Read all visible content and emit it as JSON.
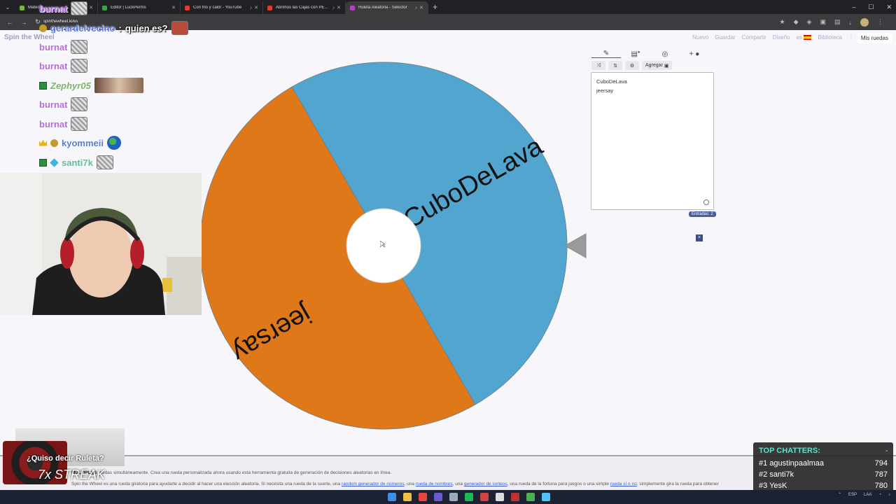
{
  "browser": {
    "tabs": [
      {
        "label": "Matecat...",
        "color": "#7cb342",
        "audio": false,
        "active": false
      },
      {
        "label": "Editor | LuckPerms",
        "color": "#43a047",
        "audio": false,
        "active": false
      },
      {
        "label": "Con frio y calor - YouTube",
        "color": "#e53935",
        "audio": true,
        "active": false
      },
      {
        "label": "Abrimos las Cajas con PEORES",
        "color": "#e53935",
        "audio": true,
        "active": false
      },
      {
        "label": "Ruleta Aleatoria - Selector",
        "color": "#ab47bc",
        "audio": true,
        "active": true
      }
    ],
    "new_tab": "+",
    "window_controls": [
      "–",
      "☐",
      "✕"
    ]
  },
  "site": {
    "logo": "Spin the Wheel",
    "nav": [
      "Nuevo",
      "Guardar",
      "Compartir",
      "Diseño",
      "es",
      "Biblioteca",
      "⋮"
    ],
    "my_wheels": "Mis ruedas"
  },
  "wheel": {
    "segments": [
      {
        "label": "CuboDeLava",
        "color": "#52a5cf"
      },
      {
        "label": "jeersay",
        "color": "#df7818"
      }
    ]
  },
  "editor": {
    "add_label": "Agregar",
    "entries": [
      "CuboDeLava",
      "jeersay"
    ],
    "entries_count": "Entradas: 2",
    "close": "×"
  },
  "chat": {
    "lines": [
      {
        "user": "burnat",
        "style": "purple"
      },
      {
        "user": "gerardelvecino",
        "style": "blue",
        "message": "quien es?"
      },
      {
        "user": "burnat",
        "style": "purple"
      },
      {
        "user": "burnat",
        "style": "purple"
      },
      {
        "user": "Zephyr05",
        "style": "rainbow"
      },
      {
        "user": "burnat",
        "style": "purple"
      },
      {
        "user": "burnat",
        "style": "purple"
      },
      {
        "user": "kyommeii",
        "style": "blue"
      },
      {
        "user": "santi7k",
        "style": "teal"
      }
    ],
    "small_tag": "spinthewheel.io/es"
  },
  "streak": {
    "question": "¿Quiso decir Ruleta?",
    "count": "7x STREAK"
  },
  "footer": {
    "line1_bold": "MÚLTIPLES",
    "line1": "ruedas simultáneamente. Crea una rueda personalizada ahora usando esta herramienta gratuita de generación de decisiones aleatorias en línea.",
    "line2_a": "Spin the Wheel es una rueda giratoria para ayudarte a decidir al hacer una elección aleatoria. Si necesita una rueda de la suerte, una",
    "link1": "random generador de números",
    "line2_b": ", una",
    "link2": "rueda de nombres",
    "line2_c": ", una",
    "link3": "generador de sorteos",
    "line2_d": ", una rueda de la fortuna para juegos o una simple",
    "link4": "rueda sí o no",
    "line2_e": ", simplemente gira la rueda para obtener"
  },
  "top_chatters": {
    "title": "TOP CHATTERS:",
    "rows": [
      {
        "rank": "#1",
        "name": "agustinpaalmaa",
        "count": "794"
      },
      {
        "rank": "#2",
        "name": "santi7k",
        "count": "787"
      },
      {
        "rank": "#3",
        "name": "YesK",
        "count": "780"
      }
    ]
  },
  "taskbar": {
    "icons": [
      "windows-icon",
      "folder-icon",
      "chrome-icon",
      "discord-icon",
      "steam-icon",
      "spotify-icon",
      "app-icon",
      "app-icon",
      "app-icon",
      "app-icon",
      "notes-icon"
    ],
    "tray": [
      "ESP",
      "LAA"
    ]
  }
}
